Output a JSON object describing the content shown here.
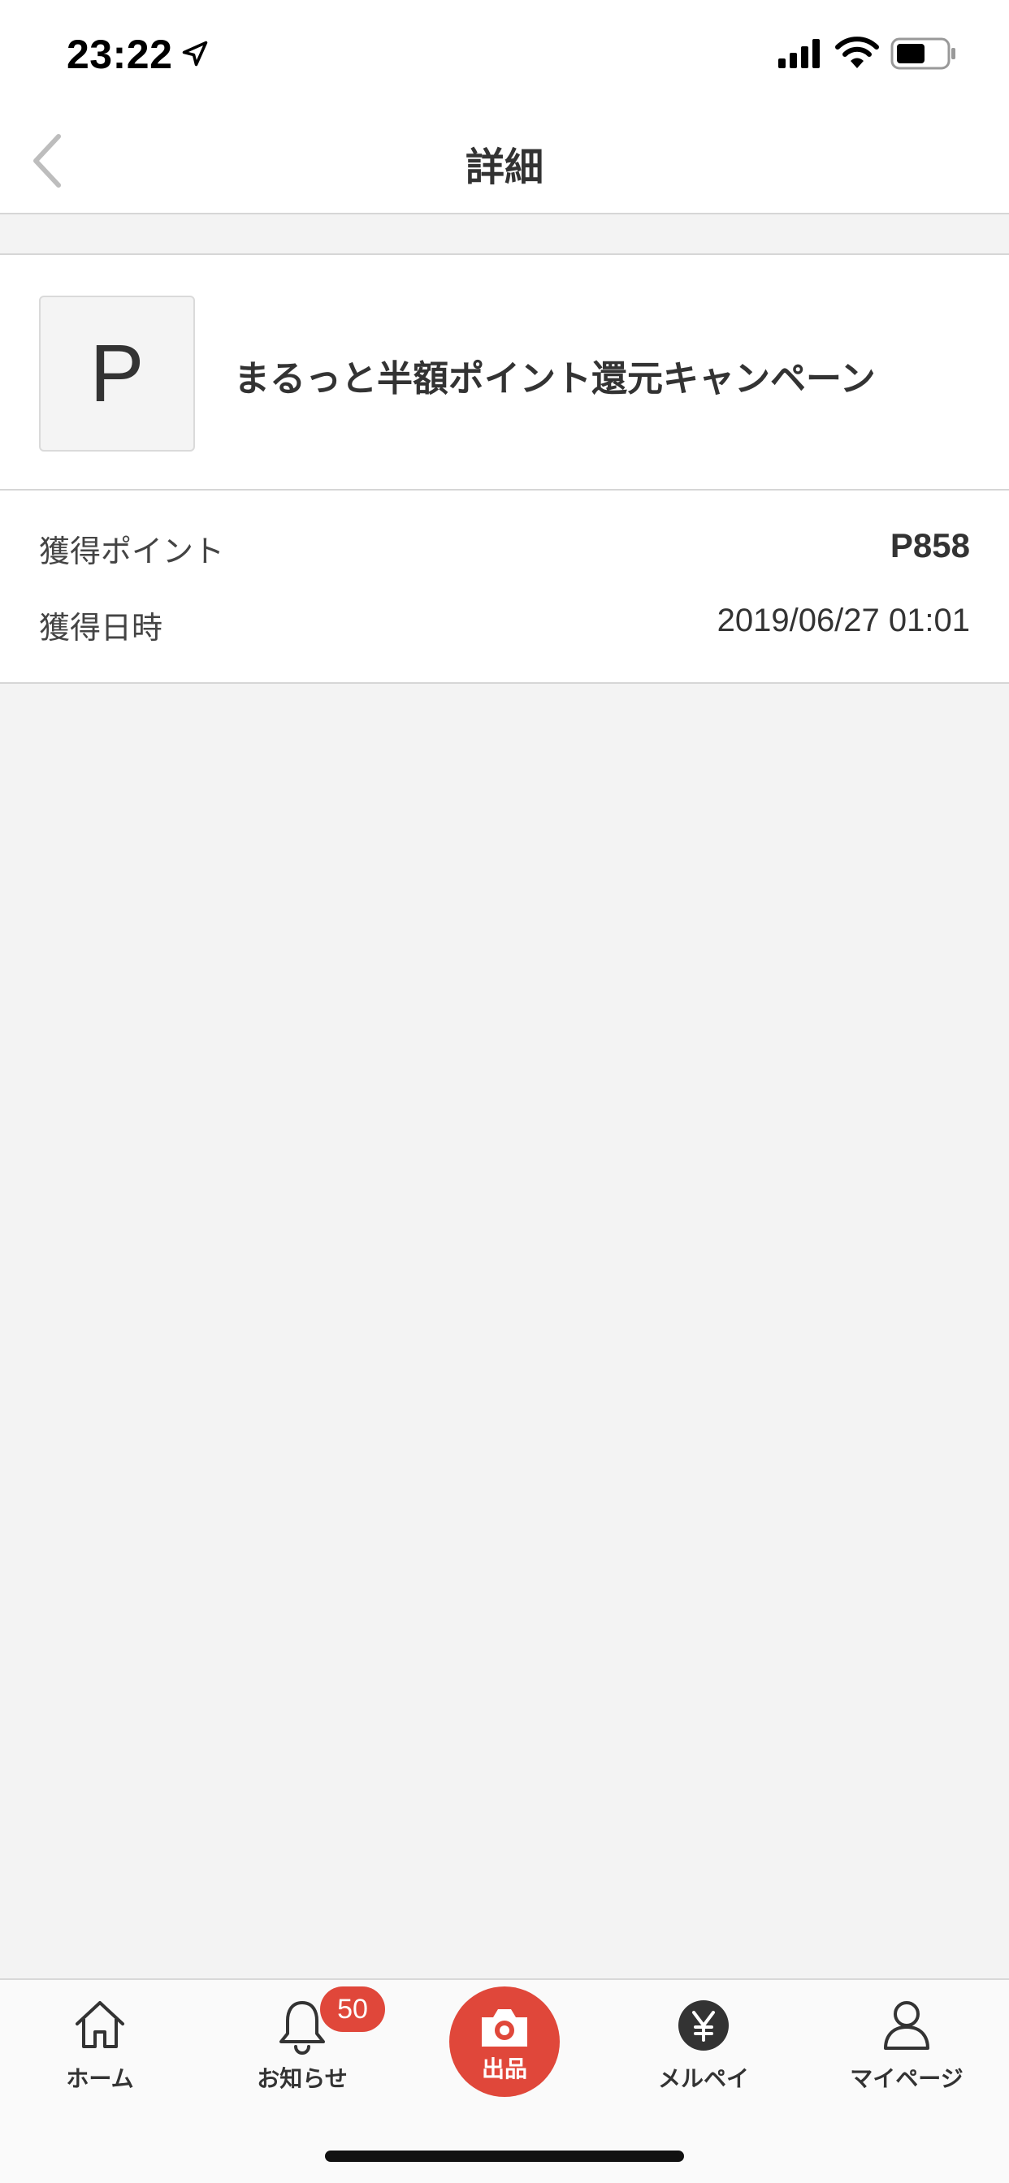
{
  "status_bar": {
    "time": "23:22"
  },
  "nav": {
    "title": "詳細"
  },
  "campaign": {
    "logo_letter": "P",
    "title": "まるっと半額ポイント還元キャンペーン"
  },
  "details": {
    "points_label": "獲得ポイント",
    "points_value": "P858",
    "date_label": "獲得日時",
    "date_value": "2019/06/27 01:01"
  },
  "tab_bar": {
    "home": "ホーム",
    "notice": "お知らせ",
    "notice_badge": "50",
    "sell": "出品",
    "merpay": "メルペイ",
    "mypage": "マイページ"
  },
  "colors": {
    "accent": "#e0473a",
    "background": "#f3f3f3",
    "text": "#333333"
  },
  "icons": [
    "location-arrow-icon",
    "signal-icon",
    "wifi-icon",
    "battery-icon",
    "chevron-left-icon",
    "home-icon",
    "bell-icon",
    "camera-icon",
    "yen-icon",
    "person-icon"
  ]
}
